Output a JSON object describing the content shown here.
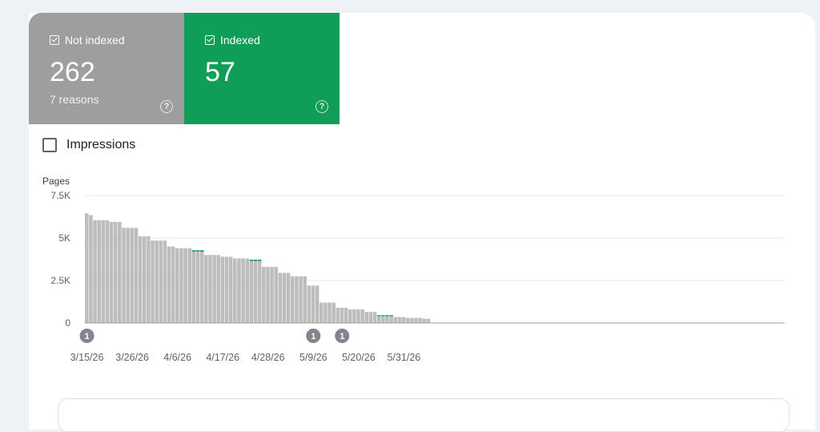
{
  "summary": {
    "not_indexed": {
      "label": "Not indexed",
      "value": "262",
      "sub": "7 reasons",
      "help_icon": "help-icon",
      "color": "#9e9e9e"
    },
    "indexed": {
      "label": "Indexed",
      "value": "57",
      "help_icon": "help-icon",
      "color": "#0f9d58"
    }
  },
  "metric_toggle": {
    "label": "Impressions",
    "checked": false
  },
  "annotations": [
    {
      "x": "3/15/26",
      "label": "1"
    },
    {
      "x": "5/9/26",
      "label": "1"
    },
    {
      "x": "5/16/26",
      "label": "1"
    }
  ],
  "chart_data": {
    "type": "bar",
    "stacked": true,
    "ylabel": "Pages",
    "ylim": [
      0,
      7500
    ],
    "yticks": [
      0,
      2500,
      5000,
      7500
    ],
    "ytick_labels": [
      "0",
      "2.5K",
      "5K",
      "7.5K"
    ],
    "xtick_labels": [
      "3/15/26",
      "3/26/26",
      "4/6/26",
      "4/17/26",
      "4/28/26",
      "5/9/26",
      "5/20/26",
      "5/31/26"
    ],
    "grid": true,
    "start_date": "3/15/26",
    "series": [
      {
        "name": "Not indexed",
        "color": "#bdbdbd",
        "values": [
          6450,
          6350,
          6050,
          6050,
          6050,
          6050,
          5950,
          5950,
          5950,
          5600,
          5600,
          5600,
          5600,
          5100,
          5100,
          5100,
          4850,
          4850,
          4850,
          4850,
          4500,
          4500,
          4400,
          4400,
          4400,
          4400,
          4200,
          4200,
          4200,
          4000,
          4000,
          4000,
          4000,
          3900,
          3900,
          3900,
          3800,
          3800,
          3800,
          3800,
          3650,
          3650,
          3650,
          3300,
          3300,
          3300,
          3300,
          2950,
          2950,
          2950,
          2750,
          2750,
          2750,
          2750,
          2200,
          2200,
          2200,
          1200,
          1200,
          1200,
          1200,
          900,
          900,
          900,
          800,
          800,
          800,
          800,
          650,
          650,
          650,
          400,
          400,
          400,
          400,
          350,
          350,
          350,
          300,
          300,
          300,
          300,
          250,
          250
        ]
      },
      {
        "name": "Indexed",
        "color": "#0f9d58",
        "values": [
          0,
          0,
          0,
          0,
          0,
          0,
          0,
          0,
          0,
          0,
          0,
          0,
          0,
          0,
          0,
          0,
          0,
          0,
          0,
          0,
          0,
          0,
          0,
          0,
          0,
          0,
          80,
          80,
          80,
          0,
          0,
          0,
          0,
          0,
          0,
          0,
          0,
          0,
          0,
          0,
          80,
          80,
          80,
          0,
          0,
          0,
          0,
          0,
          0,
          0,
          0,
          0,
          0,
          0,
          0,
          0,
          0,
          0,
          0,
          0,
          0,
          0,
          0,
          0,
          0,
          0,
          0,
          0,
          0,
          0,
          0,
          60,
          60,
          60,
          60,
          0,
          0,
          0,
          0,
          0,
          0,
          0,
          0,
          0
        ]
      }
    ]
  }
}
